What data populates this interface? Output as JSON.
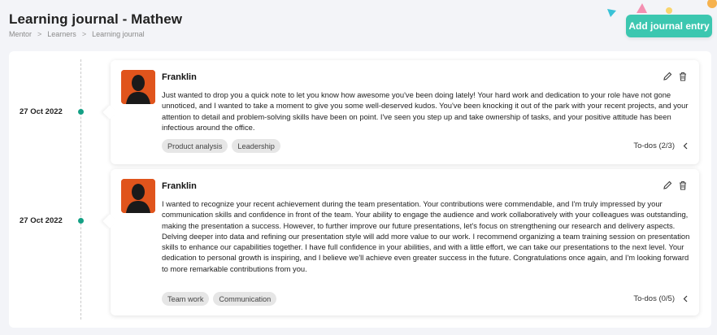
{
  "header": {
    "title": "Learning journal - Mathew",
    "breadcrumb": [
      "Mentor",
      "Learners",
      "Learning journal"
    ],
    "breadcrumb_separator": ">",
    "add_button_label": "Add journal entry"
  },
  "colors": {
    "accent": "#3cc7b0",
    "timeline_dot": "#14a085",
    "tag_bg": "#e6e6e6",
    "avatar_bg": "#e0541c"
  },
  "entries": [
    {
      "date": "27 Oct 2022",
      "author": "Franklin",
      "text": "Just wanted to drop you a quick note to let you know how awesome you've been doing lately! Your hard work and dedication to your role have not gone unnoticed, and I wanted to take a moment to give you some well-deserved kudos. You've been knocking it out of the park with your recent projects, and your attention to detail and problem-solving skills have been on point. I've seen you step up and take ownership of tasks, and your positive attitude has been infectious around the office.",
      "tags": [
        "Product analysis",
        "Leadership"
      ],
      "todos": "To-dos (2/3)"
    },
    {
      "date": "27 Oct 2022",
      "author": "Franklin",
      "text": "I wanted to recognize your recent achievement during the team presentation. Your contributions were commendable, and I'm truly impressed by your communication skills and confidence in front of the team. Your ability to engage the audience and work collaboratively with your colleagues was outstanding, making the presentation a success. However, to further improve our future presentations, let's focus on strengthening our research and delivery aspects. Delving deeper into data and refining our presentation style will add more value to our work. I recommend organizing a team training session on presentation skills to enhance our capabilities together. I have full confidence in your abilities, and with a little effort, we can take our presentations to the next level. Your dedication to personal growth is inspiring, and I believe we'll achieve even greater success in the future. Congratulations once again, and I'm looking forward to more remarkable contributions from you.",
      "tags": [
        "Team work",
        "Communication"
      ],
      "todos": "To-dos (0/5)"
    }
  ],
  "icons": {
    "edit": "pencil-icon",
    "delete": "trash-icon",
    "expand": "chevron-left-icon"
  }
}
